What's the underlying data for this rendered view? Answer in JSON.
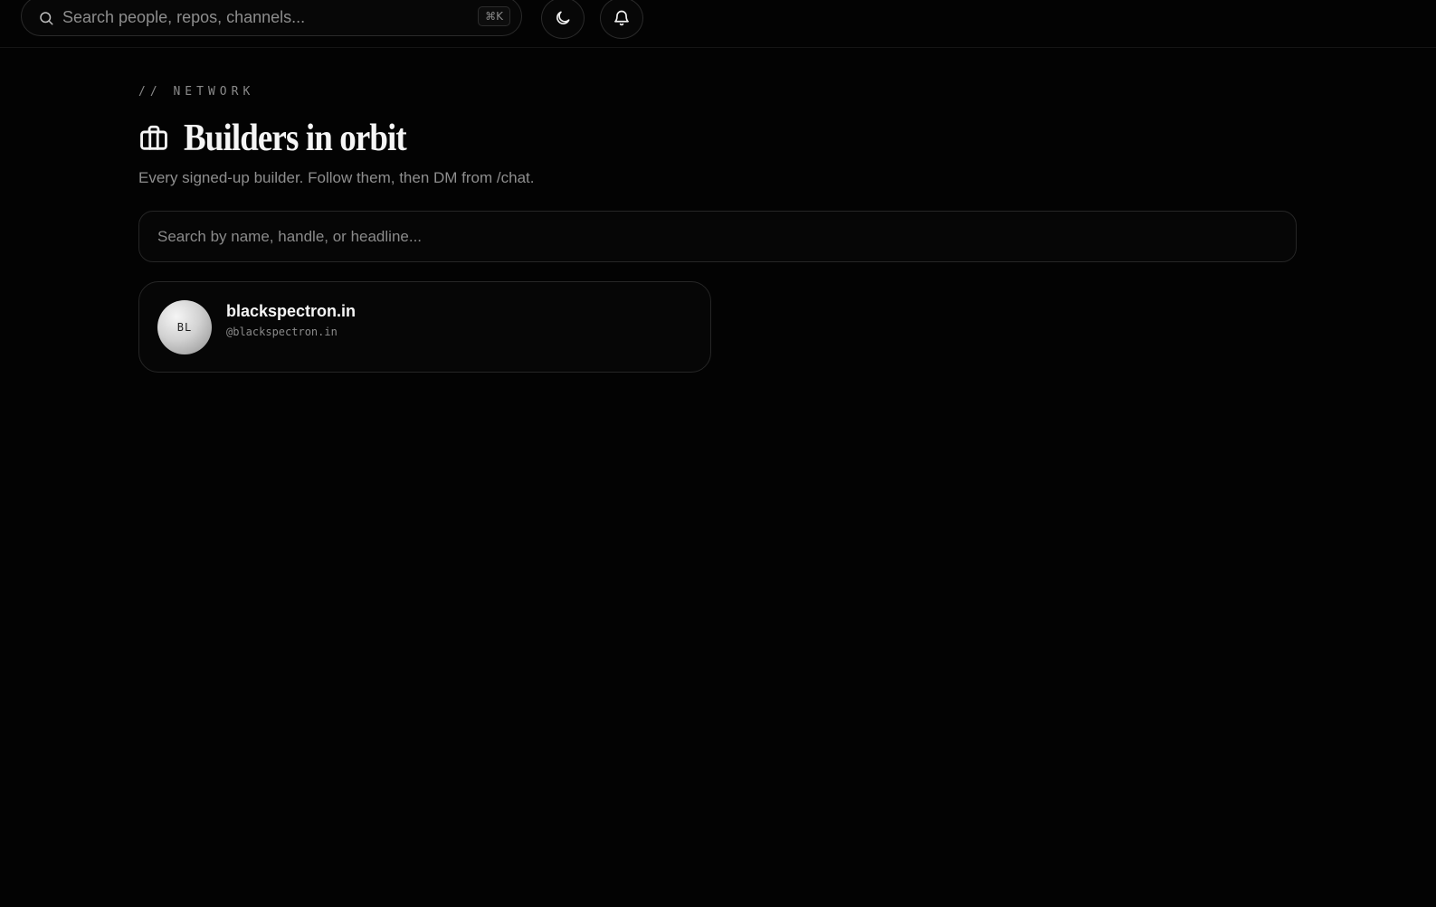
{
  "topbar": {
    "search": {
      "placeholder": "Search people, repos, channels...",
      "value": "",
      "shortcut": "⌘K"
    },
    "icons": {
      "search": "search-icon",
      "theme": "moon-icon",
      "notifications": "bell-icon"
    }
  },
  "header": {
    "eyebrow": "// NETWORK",
    "title_icon": "briefcase-icon",
    "title": "Builders in orbit",
    "subtitle": "Every signed-up builder. Follow them, then DM from /chat."
  },
  "people_search": {
    "placeholder": "Search by name, handle, or headline...",
    "value": ""
  },
  "people": [
    {
      "initials": "BL",
      "name": "blackspectron.in",
      "handle": "@blackspectron.in"
    }
  ],
  "colors": {
    "background": "#030303",
    "border": "#262626",
    "muted_text": "#8a8a8a",
    "primary_text": "#f5f5f5"
  }
}
